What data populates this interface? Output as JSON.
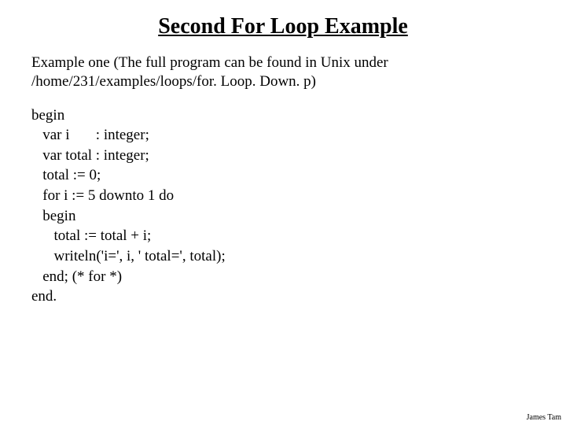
{
  "title": "Second For Loop Example",
  "intro_line1": "Example  one (The full program can be found in Unix under",
  "intro_line2": "/home/231/examples/loops/for. Loop. Down. p)",
  "code": "begin\n   var i       : integer;\n   var total : integer;\n   total := 0;\n   for i := 5 downto 1 do\n   begin\n      total := total + i;\n      writeln('i=', i, ' total=', total);\n   end; (* for *)\nend.",
  "footer": "James Tam"
}
